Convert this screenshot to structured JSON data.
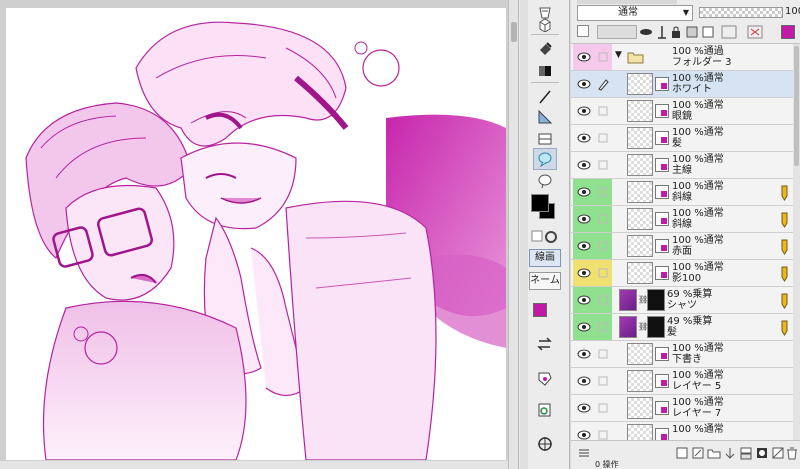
{
  "colors": {
    "accent": "#c01aa6",
    "selected_row": "#d6e3f3",
    "row_green": "#8fe08f",
    "row_yellow": "#f0e070",
    "row_pink": "#f5c8ec"
  },
  "layer_panel": {
    "blend_mode": "通常",
    "opacity": "100",
    "bottom_tab_label": "0 操作",
    "layers": [
      {
        "line1": "100 %通過",
        "line2": "フォルダー 3",
        "kind": "folder",
        "color_tag": "pink",
        "selected": false
      },
      {
        "line1": "100 %通常",
        "line2": "ホワイト",
        "kind": "raster",
        "color_tag": "none",
        "selected": true
      },
      {
        "line1": "100 %通常",
        "line2": "眼鏡",
        "kind": "raster",
        "color_tag": "none",
        "selected": false
      },
      {
        "line1": "100 %通常",
        "line2": "髪",
        "kind": "raster",
        "color_tag": "none",
        "selected": false
      },
      {
        "line1": "100 %通常",
        "line2": "主線",
        "kind": "raster",
        "color_tag": "none",
        "selected": false
      },
      {
        "line1": "100 %通常",
        "line2": "斜線",
        "kind": "raster",
        "color_tag": "green",
        "selected": false
      },
      {
        "line1": "100 %通常",
        "line2": "斜線",
        "kind": "raster",
        "color_tag": "green",
        "selected": false
      },
      {
        "line1": "100 %通常",
        "line2": "赤面",
        "kind": "raster",
        "color_tag": "green",
        "selected": false
      },
      {
        "line1": "100 %通常",
        "line2": "影100",
        "kind": "raster",
        "color_tag": "yellow",
        "selected": false
      },
      {
        "line1": "69 %乗算",
        "line2": "シャツ",
        "kind": "mask",
        "color_tag": "green",
        "selected": false
      },
      {
        "line1": "49 %乗算",
        "line2": "髪",
        "kind": "mask",
        "color_tag": "green",
        "selected": false
      },
      {
        "line1": "100 %通常",
        "line2": "下書き",
        "kind": "raster",
        "color_tag": "none",
        "selected": false
      },
      {
        "line1": "100 %通常",
        "line2": "レイヤー 5",
        "kind": "raster",
        "color_tag": "none",
        "selected": false
      },
      {
        "line1": "100 %通常",
        "line2": "レイヤー 7",
        "kind": "raster",
        "color_tag": "none",
        "selected": false
      },
      {
        "line1": "100 %通常",
        "line2": "",
        "kind": "raster",
        "color_tag": "none",
        "selected": false
      }
    ]
  },
  "toolstrip": {
    "tab_lineart": "線画",
    "tab_name": "ネーム"
  }
}
